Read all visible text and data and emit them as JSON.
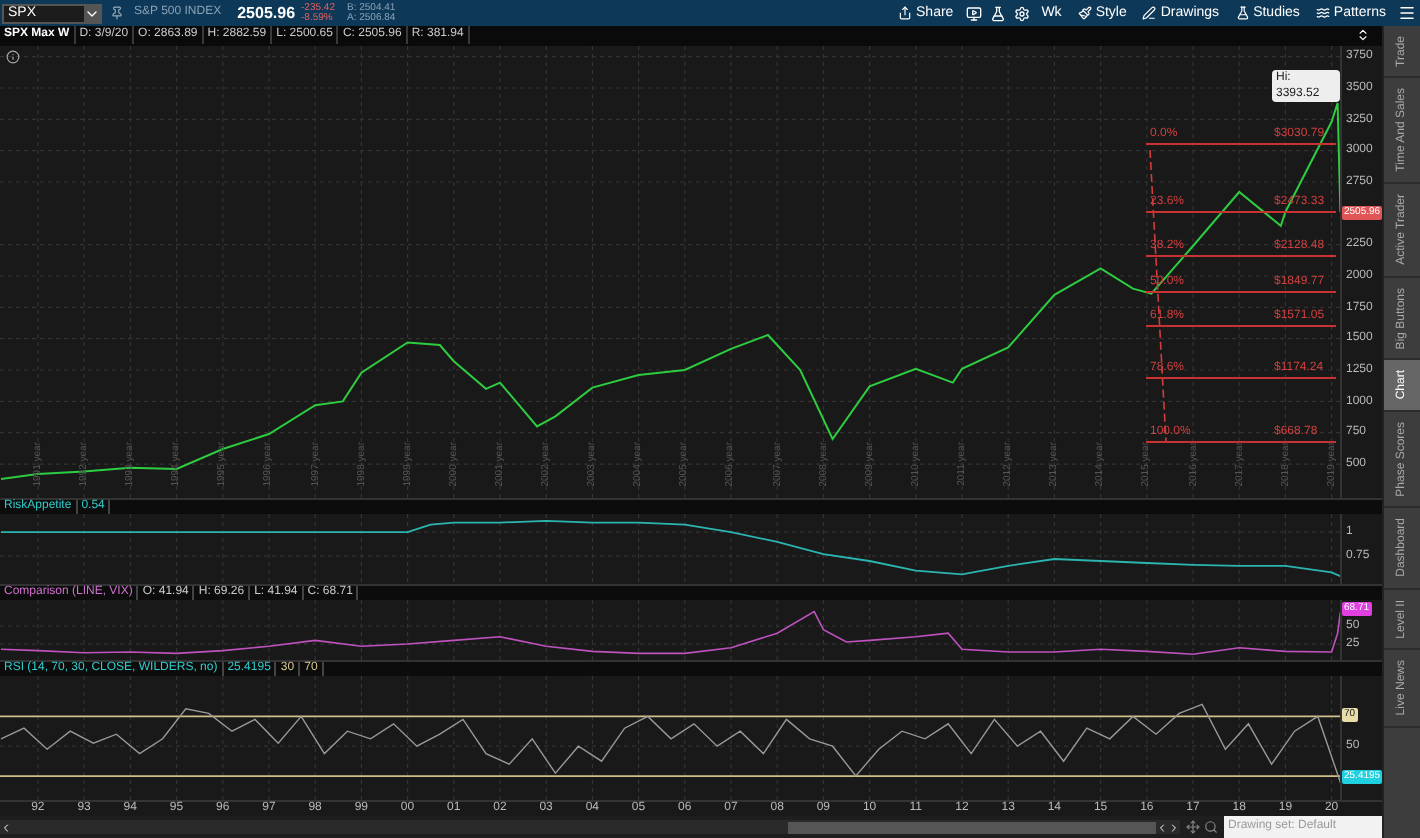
{
  "toolbar": {
    "symbol": "SPX",
    "description": "S&P 500 INDEX",
    "last": "2505.96",
    "change": "-235.42",
    "change_pct": "-8.59%",
    "bid": "B: 2504.41",
    "ask": "A: 2506.84",
    "buttons": [
      {
        "kind": "share",
        "label": "Share"
      },
      {
        "kind": "period",
        "label": "Wk"
      },
      {
        "kind": "style",
        "label": "Style"
      },
      {
        "kind": "drawings",
        "label": "Drawings"
      },
      {
        "kind": "studies",
        "label": "Studies"
      },
      {
        "kind": "patterns",
        "label": "Patterns"
      }
    ]
  },
  "header": [
    "SPX Max W",
    "D: 3/9/20",
    "O: 2863.89",
    "H: 2882.59",
    "L: 2500.65",
    "C: 2505.96",
    "R: 381.94"
  ],
  "main_chart": {
    "hi_label": "Hi: 3393.52",
    "current_price": "2505.96",
    "chart_data": {
      "type": "line",
      "grid": true,
      "ylim": [
        213,
        3835
      ],
      "xlim": [
        1990.18,
        2020.09
      ],
      "x": [
        1990.2,
        1991,
        1992,
        1993,
        1994,
        1995,
        1996,
        1997,
        1997.6,
        1998,
        1999,
        1999.7,
        2000,
        2000.7,
        2001,
        2001.8,
        2002.2,
        2003,
        2004,
        2005,
        2006,
        2006.8,
        2007.5,
        2008.2,
        2009,
        2010,
        2010.8,
        2011,
        2012,
        2013,
        2014,
        2014.7,
        2015.1,
        2016,
        2017,
        2017.9,
        2018,
        2019,
        2019.13,
        2019.19
      ],
      "series": [
        {
          "color": "#2ecc40",
          "values": [
            380,
            420,
            440,
            470,
            460,
            620,
            740,
            970,
            1000,
            1230,
            1470,
            1450,
            1320,
            1100,
            1150,
            800,
            880,
            1110,
            1210,
            1250,
            1420,
            1530,
            1250,
            700,
            1120,
            1260,
            1150,
            1260,
            1430,
            1850,
            2060,
            1900,
            1860,
            2240,
            2670,
            2400,
            2510,
            3230,
            3380,
            2510
          ]
        }
      ],
      "yticks": [
        500,
        750,
        1000,
        1250,
        1500,
        1750,
        2000,
        2250,
        2750,
        3000,
        3250,
        3500,
        3750
      ],
      "xticks": [
        {
          "value": 1991,
          "label": "1991 year"
        },
        {
          "value": 1992,
          "label": "1992 year"
        },
        {
          "value": 1993,
          "label": "1993 year"
        },
        {
          "value": 1994,
          "label": "1994 year"
        },
        {
          "value": 1995,
          "label": "1995 year"
        },
        {
          "value": 1996,
          "label": "1996 year"
        },
        {
          "value": 1997,
          "label": "1997 year"
        },
        {
          "value": 1998,
          "label": "1998 year"
        },
        {
          "value": 1999,
          "label": "1999 year"
        },
        {
          "value": 2000,
          "label": "2000 year"
        },
        {
          "value": 2001,
          "label": "2001 year"
        },
        {
          "value": 2002,
          "label": "2002 year"
        },
        {
          "value": 2003,
          "label": "2003 year"
        },
        {
          "value": 2004,
          "label": "2004 year"
        },
        {
          "value": 2005,
          "label": "2005 year"
        },
        {
          "value": 2006,
          "label": "2006 year"
        },
        {
          "value": 2007,
          "label": "2007 year"
        },
        {
          "value": 2008,
          "label": "2008 year"
        },
        {
          "value": 2009,
          "label": "2009 year"
        },
        {
          "value": 2010,
          "label": "2010 year"
        },
        {
          "value": 2011,
          "label": "2011 year"
        },
        {
          "value": 2012,
          "label": "2012 year"
        },
        {
          "value": 2013,
          "label": "2013 year"
        },
        {
          "value": 2014,
          "label": "2014 year"
        },
        {
          "value": 2015,
          "label": "2015 year"
        },
        {
          "value": 2016,
          "label": "2016 year"
        },
        {
          "value": 2017,
          "label": "2017 year"
        },
        {
          "value": 2018,
          "label": "2018 year"
        },
        {
          "value": 2019,
          "label": "2019 year"
        }
      ]
    },
    "fib_levels": [
      {
        "pct": "0.0%",
        "price": "$3030.79"
      },
      {
        "pct": "23.6%",
        "price": "$2473.33"
      },
      {
        "pct": "38.2%",
        "price": "$2128.48"
      },
      {
        "pct": "50.0%",
        "price": "$1849.77"
      },
      {
        "pct": "61.8%",
        "price": "$1571.05"
      },
      {
        "pct": "78.6%",
        "price": "$1174.24"
      },
      {
        "pct": "100.0%",
        "price": "$668.78"
      }
    ]
  },
  "risk_appetite": {
    "title": "RiskAppetite",
    "value": "0.54",
    "chart_data": {
      "type": "line",
      "grid": true,
      "ylim": [
        0.46,
        1.19
      ],
      "xlim": [
        1991.18,
        2021.09
      ],
      "yticks": [
        0.75,
        1
      ],
      "x": [
        1991.2,
        1992,
        1993,
        1994,
        1995,
        1996,
        1997,
        1998,
        1999,
        2000,
        2000.5,
        2001,
        2002,
        2003,
        2004,
        2005,
        2006,
        2007,
        2008,
        2009,
        2010,
        2011,
        2012,
        2013,
        2014,
        2015,
        2016,
        2017,
        2018,
        2019,
        2020,
        2020.2
      ],
      "series": [
        {
          "color": "#2bb5b0",
          "values": [
            1,
            1,
            1,
            1,
            1,
            1,
            1,
            1,
            1,
            1,
            1.08,
            1.1,
            1.1,
            1.12,
            1.1,
            1.1,
            1.08,
            1,
            0.9,
            0.77,
            0.7,
            0.6,
            0.56,
            0.65,
            0.72,
            0.7,
            0.68,
            0.66,
            0.65,
            0.65,
            0.58,
            0.54
          ]
        }
      ]
    }
  },
  "comparison": {
    "title": "Comparison (LINE, VIX)",
    "fields": [
      "O: 41.94",
      "H: 69.26",
      "L: 41.94",
      "C: 68.71"
    ],
    "badge": "68.71",
    "chart_data": {
      "type": "line",
      "grid": true,
      "ylim": [
        3,
        86
      ],
      "xlim": [
        1991.18,
        2021.09
      ],
      "yticks": [
        25,
        50
      ],
      "x": [
        1991.2,
        1992,
        1993,
        1994,
        1995,
        1996,
        1997,
        1998,
        1999,
        2000,
        2001,
        2002,
        2003,
        2004,
        2005,
        2006,
        2007,
        2008,
        2008.8,
        2009,
        2009.5,
        2010,
        2011,
        2011.7,
        2012,
        2013,
        2014,
        2015,
        2016,
        2017,
        2018,
        2019,
        2020,
        2020.13,
        2020.19
      ],
      "series": [
        {
          "color": "#c052c0",
          "values": [
            18,
            16,
            13,
            14,
            12,
            16,
            22,
            30,
            22,
            25,
            30,
            35,
            22,
            15,
            12,
            12,
            20,
            40,
            70,
            45,
            28,
            30,
            35,
            40,
            18,
            14,
            14,
            18,
            15,
            11,
            20,
            15,
            14,
            40,
            69
          ]
        }
      ]
    }
  },
  "rsi": {
    "title": "RSI (14, 70, 30, CLOSE, WILDERS, no)",
    "value": "25.4195",
    "oversold": "30",
    "overbought": "70",
    "badge": "25.4195",
    "chart_data": {
      "type": "line",
      "grid": true,
      "ylim": [
        14,
        97
      ],
      "xlim": [
        1991.18,
        2021.09
      ],
      "yticks": [
        {
          "value": 70,
          "label": "70"
        },
        50
      ],
      "ref_lines": [
        {
          "axis": "y",
          "value": 70
        },
        {
          "axis": "y",
          "value": 30
        }
      ],
      "x": [
        1991.2,
        1991.7,
        1992.2,
        1992.7,
        1993.2,
        1993.7,
        1994.2,
        1994.7,
        1995.2,
        1995.7,
        1996.2,
        1996.7,
        1997.2,
        1997.7,
        1998.2,
        1998.7,
        1999.2,
        1999.7,
        2000.2,
        2000.7,
        2001.2,
        2001.7,
        2002.2,
        2002.7,
        2003.2,
        2003.7,
        2004.2,
        2004.7,
        2005.2,
        2005.7,
        2006.2,
        2006.7,
        2007.2,
        2007.7,
        2008.2,
        2008.7,
        2009.2,
        2009.7,
        2010.2,
        2010.7,
        2011.2,
        2011.7,
        2012.2,
        2012.7,
        2013.2,
        2013.7,
        2014.2,
        2014.7,
        2015.2,
        2015.7,
        2016.2,
        2016.7,
        2017.2,
        2017.7,
        2018.2,
        2018.7,
        2019.2,
        2019.7,
        2020.2
      ],
      "series": [
        {
          "color": "#999999",
          "values": [
            55,
            62,
            48,
            60,
            52,
            58,
            45,
            55,
            75,
            72,
            60,
            68,
            52,
            70,
            45,
            60,
            55,
            65,
            50,
            58,
            68,
            45,
            38,
            55,
            32,
            50,
            40,
            62,
            70,
            55,
            65,
            50,
            60,
            45,
            68,
            55,
            50,
            30,
            48,
            60,
            55,
            65,
            45,
            68,
            50,
            60,
            40,
            62,
            55,
            70,
            58,
            72,
            78,
            48,
            65,
            38,
            60,
            70,
            25
          ]
        }
      ],
      "xticks": [
        {
          "value": 1992,
          "label": "92"
        },
        {
          "value": 1993,
          "label": "93"
        },
        {
          "value": 1994,
          "label": "94"
        },
        {
          "value": 1995,
          "label": "95"
        },
        {
          "value": 1996,
          "label": "96"
        },
        {
          "value": 1997,
          "label": "97"
        },
        {
          "value": 1998,
          "label": "98"
        },
        {
          "value": 1999,
          "label": "99"
        },
        {
          "value": 2000,
          "label": "00"
        },
        {
          "value": 2001,
          "label": "01"
        },
        {
          "value": 2002,
          "label": "02"
        },
        {
          "value": 2003,
          "label": "03"
        },
        {
          "value": 2004,
          "label": "04"
        },
        {
          "value": 2005,
          "label": "05"
        },
        {
          "value": 2006,
          "label": "06"
        },
        {
          "value": 2007,
          "label": "07"
        },
        {
          "value": 2008,
          "label": "08"
        },
        {
          "value": 2009,
          "label": "09"
        },
        {
          "value": 2010,
          "label": "10"
        },
        {
          "value": 2011,
          "label": "11"
        },
        {
          "value": 2012,
          "label": "12"
        },
        {
          "value": 2013,
          "label": "13"
        },
        {
          "value": 2014,
          "label": "14"
        },
        {
          "value": 2015,
          "label": "15"
        },
        {
          "value": 2016,
          "label": "16"
        },
        {
          "value": 2017,
          "label": "17"
        },
        {
          "value": 2018,
          "label": "18"
        },
        {
          "value": 2019,
          "label": "19"
        },
        {
          "value": 2020,
          "label": "20"
        }
      ]
    }
  },
  "status": {
    "drawing_set": "Drawing set: Default"
  },
  "side_tabs": [
    {
      "label": "Trade",
      "selected": false
    },
    {
      "label": "Time And Sales",
      "selected": false
    },
    {
      "label": "Active Trader",
      "selected": false
    },
    {
      "label": "Big Buttons",
      "selected": false
    },
    {
      "label": "Chart",
      "selected": true
    },
    {
      "label": "Phase Scores",
      "selected": false
    },
    {
      "label": "Dashboard",
      "selected": false
    },
    {
      "label": "Level II",
      "selected": false
    },
    {
      "label": "Live News",
      "selected": false
    }
  ]
}
